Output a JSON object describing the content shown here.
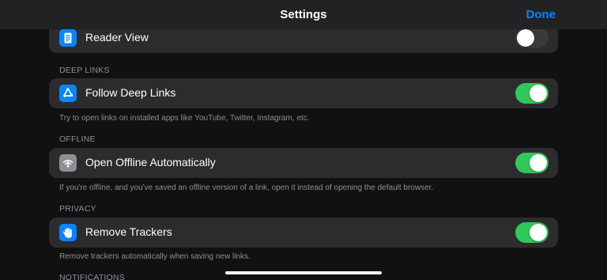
{
  "navbar": {
    "title": "Settings",
    "done_label": "Done"
  },
  "rows": {
    "reader_view": {
      "label": "Reader View",
      "enabled": false,
      "icon": "document-icon"
    },
    "follow_deep_links": {
      "label": "Follow Deep Links",
      "enabled": true,
      "icon": "recycle-icon"
    },
    "open_offline": {
      "label": "Open Offline Automatically",
      "enabled": true,
      "icon": "wifi-off-icon"
    },
    "remove_trackers": {
      "label": "Remove Trackers",
      "enabled": true,
      "icon": "hand-icon"
    }
  },
  "sections": {
    "deep_links": {
      "header": "DEEP LINKS",
      "footer": "Try to open links on installed apps like YouTube, Twitter, Instagram, etc."
    },
    "offline": {
      "header": "OFFLINE",
      "footer": "If you're offline, and you've saved an offline version of a link, open it instead of opening the default browser."
    },
    "privacy": {
      "header": "PRIVACY",
      "footer": "Remove trackers automatically when saving new links."
    },
    "notifications": {
      "header": "NOTIFICATIONS"
    }
  },
  "colors": {
    "accent": "#0a84ff",
    "toggle_on": "#30c85a",
    "toggle_off": "#3a3a3c",
    "card_bg": "#2c2c2e",
    "secondary_text": "#8e8e93"
  }
}
